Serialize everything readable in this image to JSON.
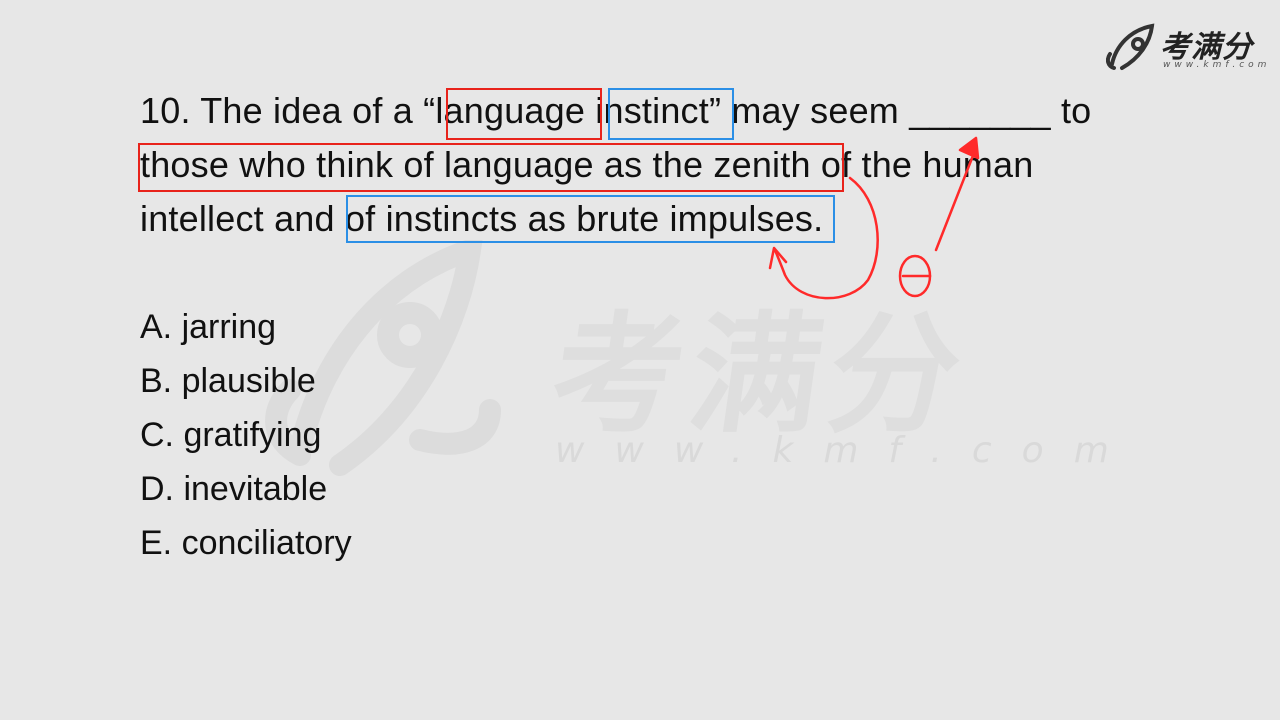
{
  "brand": {
    "logo_text": "考满分",
    "logo_url": "www.kmf.com",
    "watermark_text": "考满分",
    "watermark_url": "www.kmf.com"
  },
  "question": {
    "line1_a": "10. The idea of a “",
    "line1_b": "language",
    "line1_c": " ",
    "line1_d": "instinct",
    "line1_e": "” may seem _______ to",
    "line2_a": "those who think of language as the zenith",
    "line2_b": " of the human",
    "line3_a": "intellect and ",
    "line3_b": "of instincts as brute impulses",
    "line3_c": "."
  },
  "options": [
    {
      "label": "A. jarring"
    },
    {
      "label": "B. plausible"
    },
    {
      "label": "C. gratifying"
    },
    {
      "label": "D. inevitable"
    },
    {
      "label": "E. conciliatory"
    }
  ],
  "colors": {
    "red_box": "#e8231b",
    "blue_box": "#2b8fe6",
    "annotation": "#ff2a2a"
  }
}
